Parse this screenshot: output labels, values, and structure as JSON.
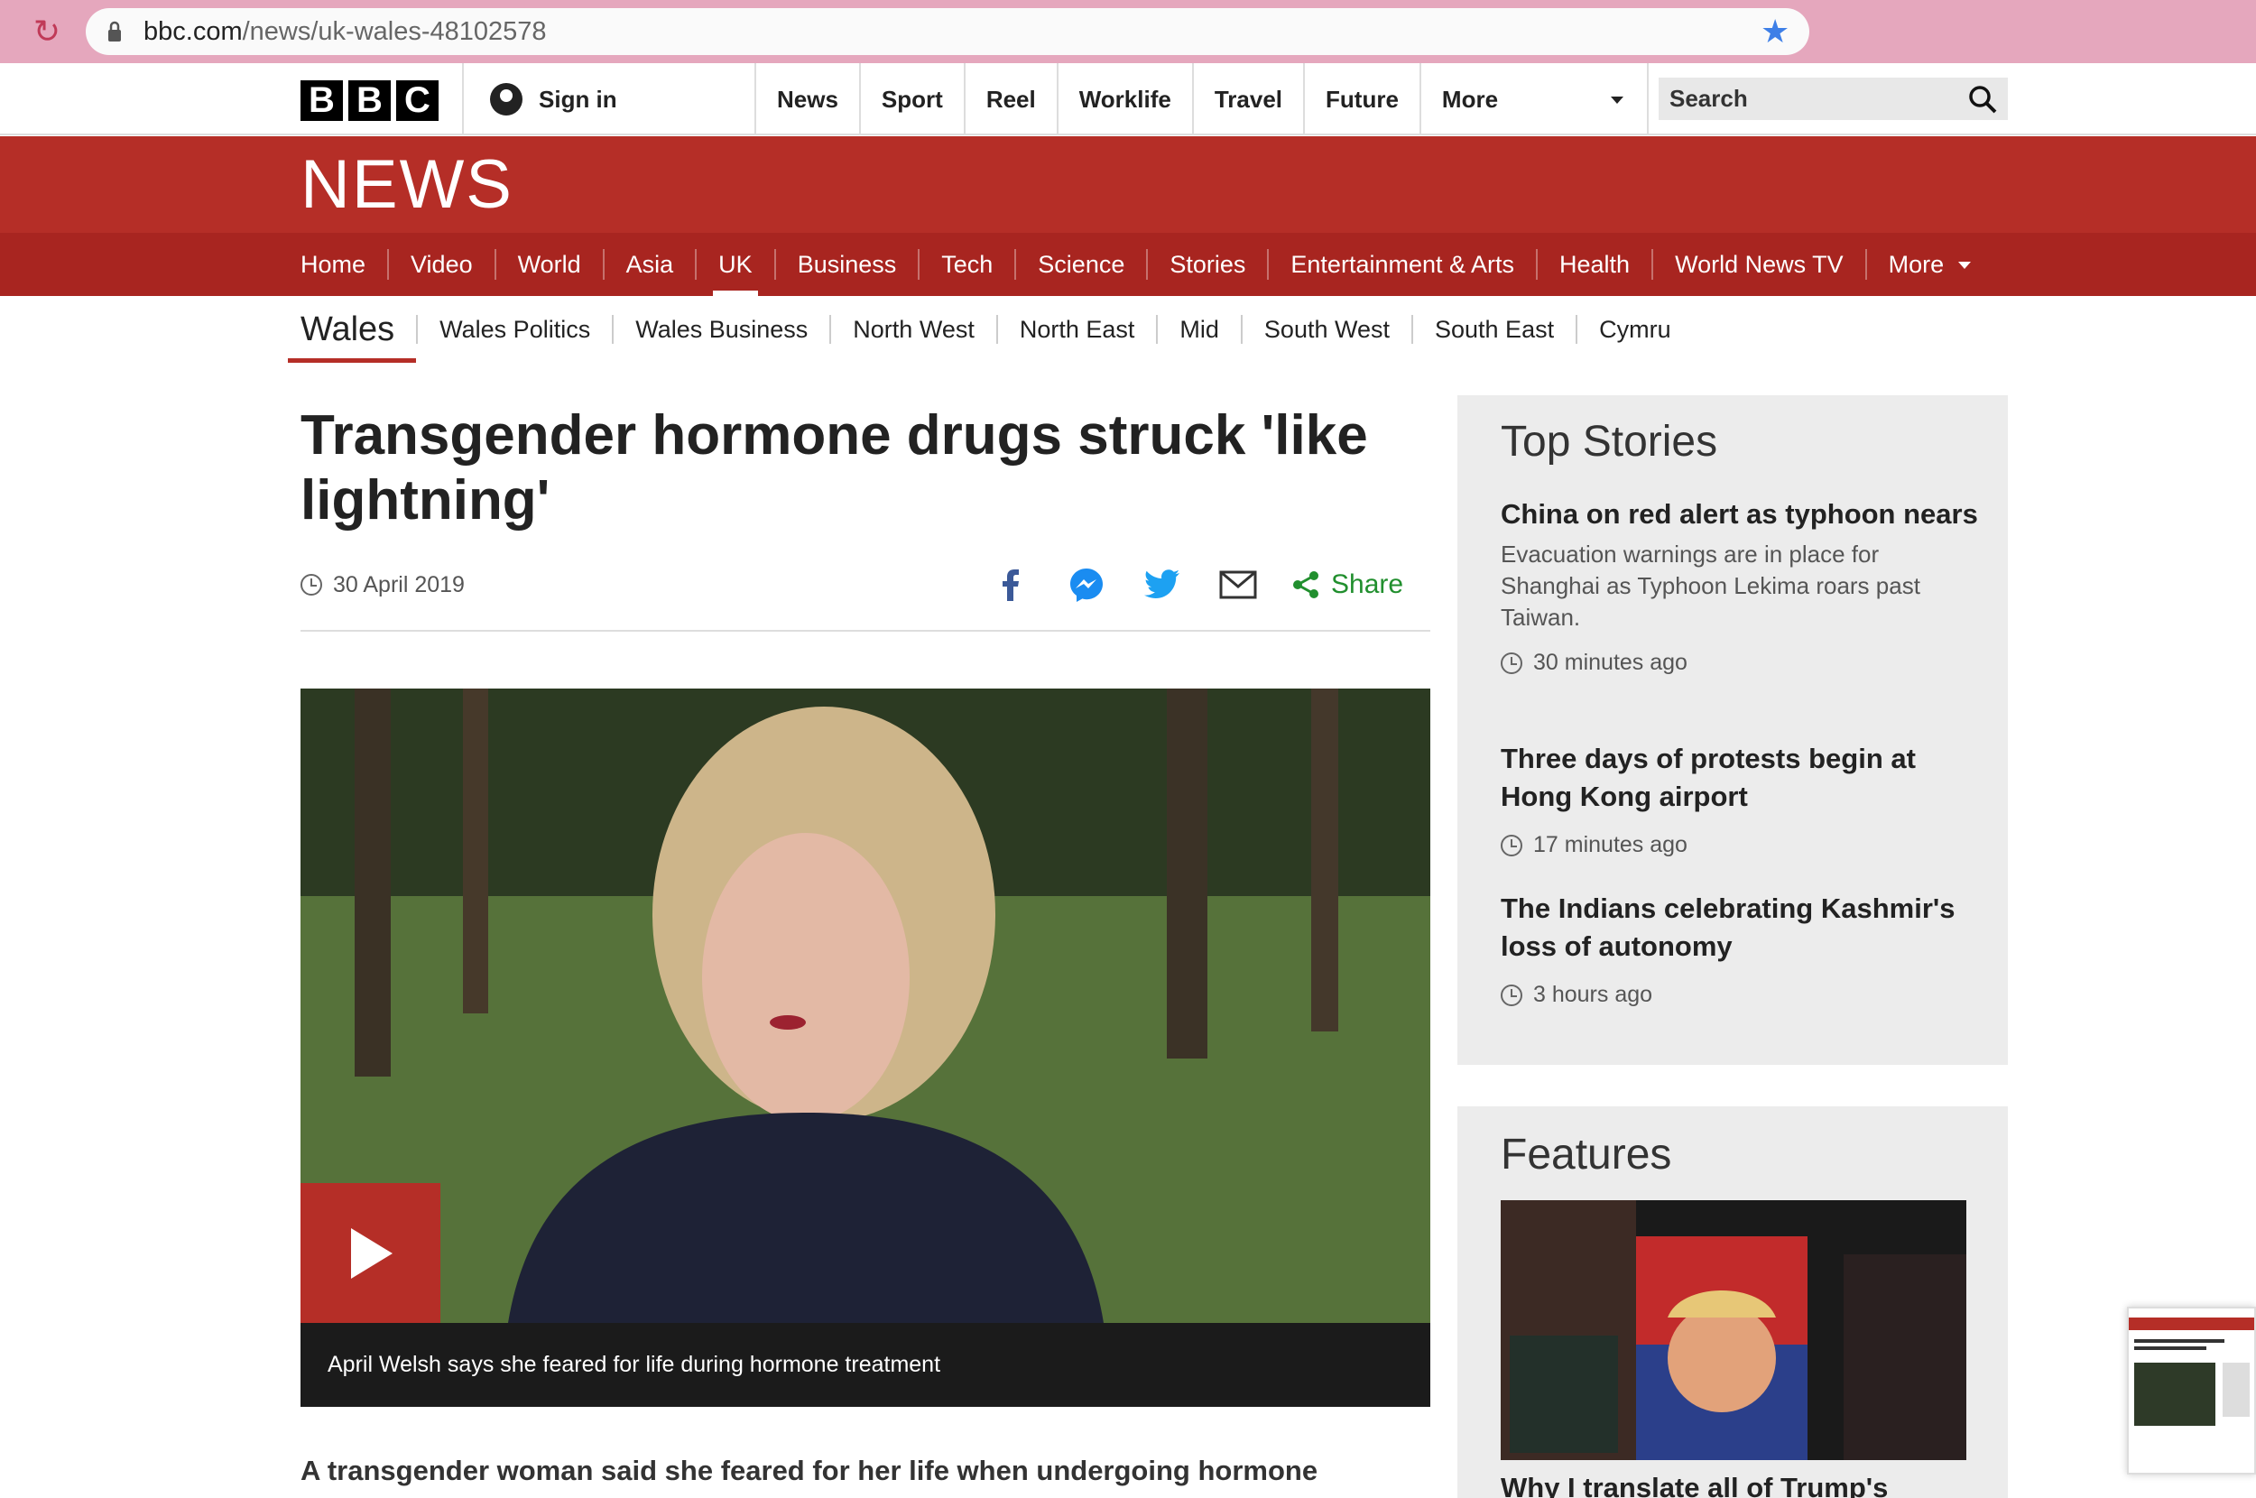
{
  "browser": {
    "url_host": "bbc.com",
    "url_path": "/news/uk-wales-48102578"
  },
  "topbar": {
    "logo_letters": [
      "B",
      "B",
      "C"
    ],
    "signin_label": "Sign in",
    "nav": [
      "News",
      "Sport",
      "Reel",
      "Worklife",
      "Travel",
      "Future",
      "More"
    ],
    "search_placeholder": "Search"
  },
  "news_banner": {
    "title": "NEWS"
  },
  "main_nav": {
    "items": [
      "Home",
      "Video",
      "World",
      "Asia",
      "UK",
      "Business",
      "Tech",
      "Science",
      "Stories",
      "Entertainment & Arts",
      "Health",
      "World News TV",
      "More"
    ],
    "active": "UK"
  },
  "sub_nav": {
    "section": "Wales",
    "items": [
      "Wales Politics",
      "Wales Business",
      "North West",
      "North East",
      "Mid",
      "South West",
      "South East",
      "Cymru"
    ]
  },
  "article": {
    "headline": "Transgender hormone drugs struck 'like lightning'",
    "date": "30 April 2019",
    "share_label": "Share",
    "video_caption": "April Welsh says she feared for life during hormone treatment",
    "lead": "A transgender woman said she feared for her life when undergoing hormone"
  },
  "top_stories": {
    "title": "Top Stories",
    "stories": [
      {
        "title": "China on red alert as typhoon nears",
        "summary": "Evacuation warnings are in place for Shanghai as Typhoon Lekima roars past Taiwan.",
        "time": "30 minutes ago"
      },
      {
        "title": "Three days of protests begin at Hong Kong airport",
        "summary": "",
        "time": "17 minutes ago"
      },
      {
        "title": "The Indians celebrating Kashmir's loss of autonomy",
        "summary": "",
        "time": "3 hours ago"
      }
    ]
  },
  "features": {
    "title": "Features",
    "first_title": "Why I translate all of Trump's"
  },
  "colors": {
    "bbc_red": "#b52e27",
    "nav_red": "#a82520",
    "share_green": "#218f2e",
    "browser_tab": "#e5a7bd"
  }
}
